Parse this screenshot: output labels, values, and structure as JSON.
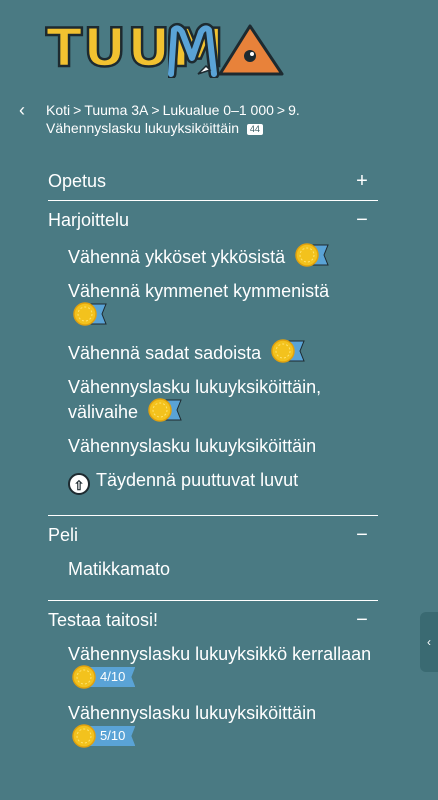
{
  "logo": {
    "text": "TUUM"
  },
  "breadcrumb": {
    "items": [
      "Koti",
      "Tuuma 3A",
      "Lukualue 0–1 000",
      "9. Vähennyslasku lukuyksiköittäin"
    ],
    "separator": ">",
    "count": "44"
  },
  "sections": [
    {
      "title": "Opetus",
      "toggle": "+"
    },
    {
      "title": "Harjoittelu",
      "toggle": "−",
      "items": [
        "Vähennä ykköset ykkösistä",
        "Vähennä kymmenet kymmenistä",
        "Vähennä sadat sadoista",
        "Vähennyslasku lukuyksiköittäin, välivaihe",
        "Vähennyslasku lukuyksiköittäin",
        "Täydennä puuttuvat luvut"
      ]
    },
    {
      "title": "Peli",
      "toggle": "−",
      "items": [
        "Matikkamato"
      ]
    },
    {
      "title": "Testaa taitosi!",
      "toggle": "−",
      "items": [
        {
          "label": "Vähennyslasku lukuyksikkö kerrallaan",
          "score": "4/10"
        },
        {
          "label": "Vähennyslasku lukuyksiköittäin",
          "score": "5/10"
        }
      ]
    }
  ],
  "icons": {
    "back": "chevron-left-icon",
    "medal": "gold-medal-icon",
    "upload": "arrow-up-circle-icon",
    "side": "chevron-left-icon"
  },
  "colors": {
    "background": "#4a7a83",
    "logo_yellow": "#f2c230",
    "logo_blue": "#5aa3d6",
    "logo_orange": "#e8823a",
    "medal": "#f3c21d",
    "ribbon": "#5aa3d6"
  }
}
